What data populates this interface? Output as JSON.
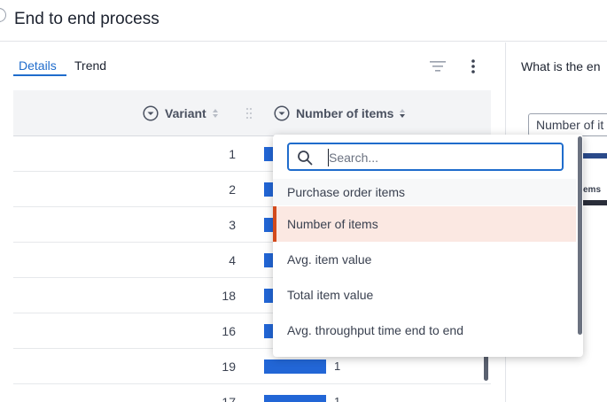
{
  "header": {
    "title": "End to end process"
  },
  "tabs": [
    {
      "label": "Details",
      "active": true
    },
    {
      "label": "Trend",
      "active": false
    }
  ],
  "toolbar": {
    "filter_icon": "filter-icon",
    "more_icon": "kebab-icon"
  },
  "table": {
    "columns": [
      {
        "label": "Variant",
        "icon": "circle-chevron-down-icon",
        "sort": "none"
      },
      {
        "label": "Number of items",
        "icon": "circle-chevron-down-icon",
        "sort": "descending"
      }
    ],
    "rows": [
      {
        "variant": "1",
        "items": ""
      },
      {
        "variant": "2",
        "items": ""
      },
      {
        "variant": "3",
        "items": ""
      },
      {
        "variant": "4",
        "items": ""
      },
      {
        "variant": "18",
        "items": ""
      },
      {
        "variant": "16",
        "items": ""
      },
      {
        "variant": "19",
        "items": "1"
      },
      {
        "variant": "17",
        "items": "1"
      }
    ]
  },
  "dropdown": {
    "search": {
      "placeholder": "Search...",
      "value": ""
    },
    "group_label": "Purchase order items",
    "options": [
      {
        "label": "Number of items",
        "selected": true
      },
      {
        "label": "Avg. item value",
        "selected": false
      },
      {
        "label": "Total item value",
        "selected": false
      },
      {
        "label": "Avg. throughput time end to end",
        "selected": false
      }
    ]
  },
  "right_panel": {
    "title": "What is the en",
    "select_value": "Number of it",
    "axis_label": "ems"
  },
  "colors": {
    "accent": "#1f6ccc",
    "bar": "#2266d6",
    "selected_bg": "#fbe8e2",
    "selected_border": "#d24a1c"
  }
}
